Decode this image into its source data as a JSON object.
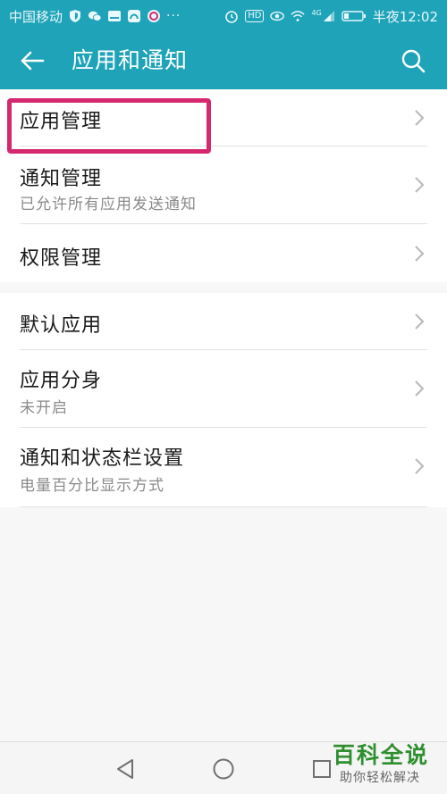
{
  "status_bar": {
    "carrier": "中国移动",
    "dots": "···",
    "network_label": "4G",
    "hd_label": "HD",
    "time": "半夜12:02"
  },
  "app_bar": {
    "title": "应用和通知"
  },
  "section_1": [
    {
      "title": "应用管理",
      "subtitle": ""
    },
    {
      "title": "通知管理",
      "subtitle": "已允许所有应用发送通知"
    },
    {
      "title": "权限管理",
      "subtitle": ""
    }
  ],
  "section_2": [
    {
      "title": "默认应用",
      "subtitle": ""
    },
    {
      "title": "应用分身",
      "subtitle": "未开启"
    },
    {
      "title": "通知和状态栏设置",
      "subtitle": "电量百分比显示方式"
    }
  ],
  "watermark": {
    "title": "百科全说",
    "subtitle": "助你轻松解决"
  },
  "colors": {
    "accent": "#1fa3b8",
    "highlight": "#d6286f"
  }
}
